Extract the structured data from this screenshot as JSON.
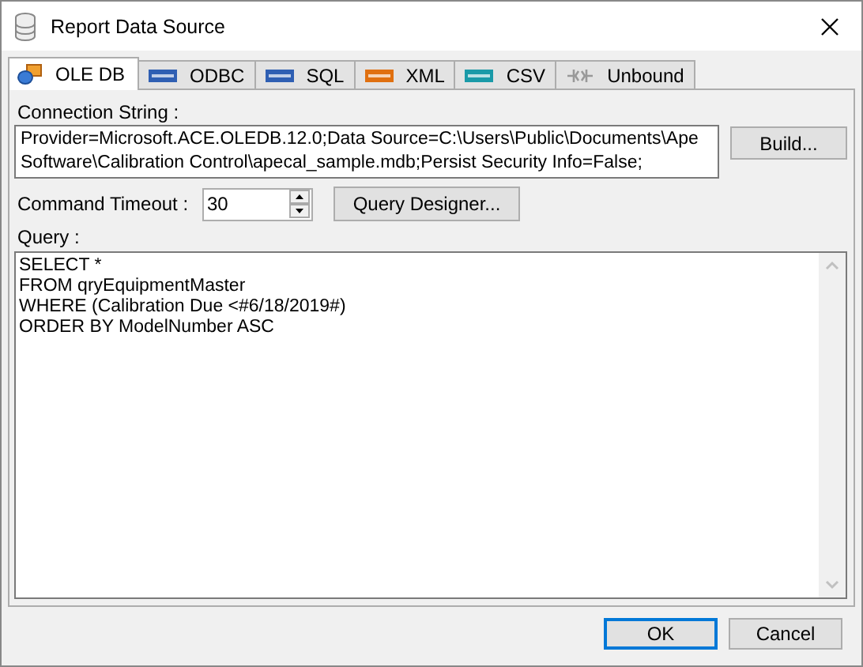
{
  "window": {
    "title": "Report Data Source"
  },
  "tabs": [
    {
      "label": "OLE DB",
      "selected": true,
      "kind": "oledb"
    },
    {
      "label": "ODBC",
      "selected": false,
      "kind": "badge",
      "color": "#2f5fb3"
    },
    {
      "label": "SQL",
      "selected": false,
      "kind": "badge",
      "color": "#2f5fb3"
    },
    {
      "label": "XML",
      "selected": false,
      "kind": "badge",
      "color": "#e07010"
    },
    {
      "label": "CSV",
      "selected": false,
      "kind": "badge",
      "color": "#1a9aa8"
    },
    {
      "label": "Unbound",
      "selected": false,
      "kind": "unbound"
    }
  ],
  "connection": {
    "label": "Connection String :",
    "value": "Provider=Microsoft.ACE.OLEDB.12.0;Data Source=C:\\Users\\Public\\Documents\\Ape Software\\Calibration Control\\apecal_sample.mdb;Persist Security Info=False;",
    "build_button": "Build..."
  },
  "timeout": {
    "label": "Command Timeout :",
    "value": "30",
    "designer_button": "Query Designer..."
  },
  "query": {
    "label": "Query :",
    "lines": [
      "SELECT *",
      "FROM qryEquipmentMaster",
      "WHERE (Calibration Due <#6/18/2019#)",
      "ORDER BY ModelNumber ASC"
    ]
  },
  "buttons": [
    {
      "label": "OK",
      "default": true
    },
    {
      "label": "Cancel",
      "default": false
    }
  ]
}
